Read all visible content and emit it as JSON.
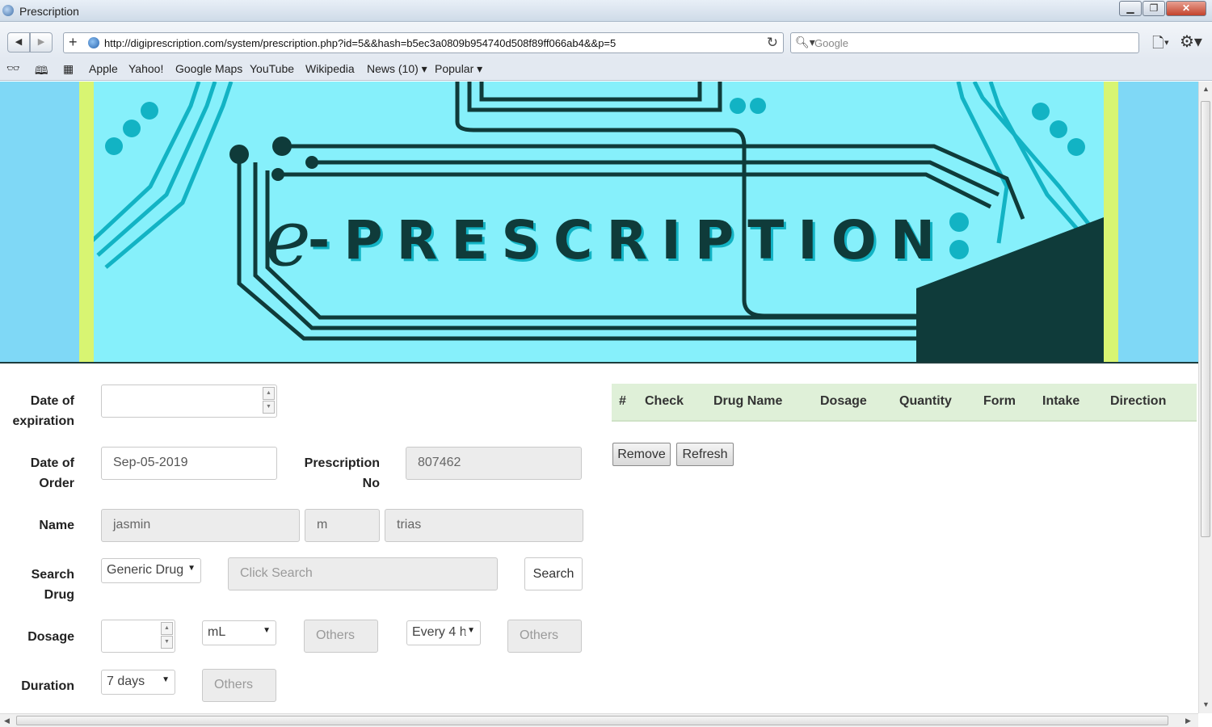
{
  "window": {
    "title": "Prescription"
  },
  "toolbar": {
    "url": "http://digiprescription.com/system/prescription.php?id=5&&hash=b5ec3a0809b954740d508f89ff066ab4&&p=5",
    "search_placeholder": "Google"
  },
  "bookmarks": {
    "items": [
      "Apple",
      "Yahoo!",
      "Google Maps",
      "YouTube",
      "Wikipedia",
      "News (10) ▾",
      "Popular ▾"
    ]
  },
  "banner": {
    "logo_e": "e",
    "logo_text": "-PRESCRIPTION"
  },
  "form": {
    "date_expiration_label_1": "Date of",
    "date_expiration_label_2": "expiration",
    "date_expiration_value": "",
    "date_order_label_1": "Date of",
    "date_order_label_2": "Order",
    "date_order_value": "Sep-05-2019",
    "prescription_no_label_1": "Prescription",
    "prescription_no_label_2": "No",
    "prescription_no_value": "807462",
    "name_label": "Name",
    "first_name": "jasmin",
    "middle_name": "m",
    "last_name": "trias",
    "search_drug_label_1": "Search",
    "search_drug_label_2": "Drug",
    "drug_type_selected": "Generic Drug",
    "click_search_placeholder": "Click Search",
    "search_button": "Search",
    "dosage_label": "Dosage",
    "dosage_value": "",
    "unit_selected": "mL",
    "unit_others_placeholder": "Others",
    "frequency_selected": "Every 4 h",
    "frequency_others_placeholder": "Others",
    "duration_label": "Duration",
    "duration_selected": "7 days",
    "duration_others_placeholder": "Others"
  },
  "table": {
    "columns": [
      "#",
      "Check",
      "Drug Name",
      "Dosage",
      "Quantity",
      "Form",
      "Intake",
      "Direction"
    ],
    "rows": []
  },
  "actions": {
    "remove": "Remove",
    "refresh": "Refresh"
  },
  "colors": {
    "banner_bg": "#86f0fb",
    "banner_side": "#7fd8f6",
    "banner_stripe": "#d8f572",
    "circuit_dark": "#0f3b3a",
    "circuit_teal": "#12b3c4",
    "table_header": "#dff0d8"
  }
}
